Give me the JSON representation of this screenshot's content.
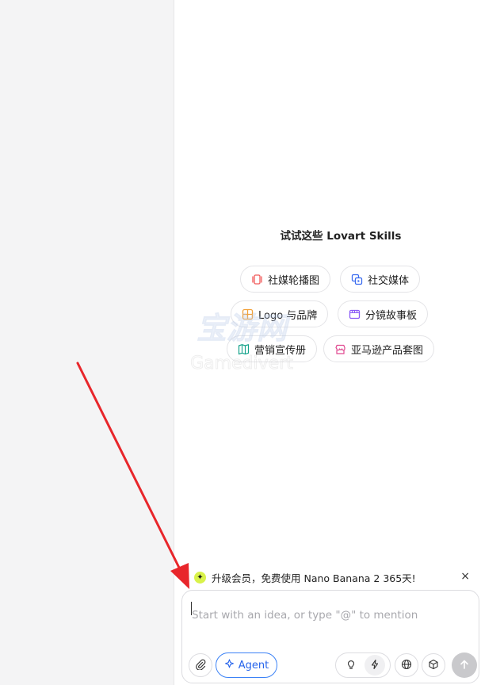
{
  "skills": {
    "title": "试试这些 Lovart Skills",
    "chips": [
      {
        "label": "社媒轮播图",
        "icon": "carousel-icon",
        "color": "#f05a5a"
      },
      {
        "label": "社交媒体",
        "icon": "social-media-icon",
        "color": "#3b6cf0"
      },
      {
        "label": "Logo 与品牌",
        "icon": "logo-brand-icon",
        "color": "#f2a13a"
      },
      {
        "label": "分镜故事板",
        "icon": "storyboard-icon",
        "color": "#8b5cf6"
      },
      {
        "label": "营销宣传册",
        "icon": "brochure-icon",
        "color": "#14a38b"
      },
      {
        "label": "亚马逊产品套图",
        "icon": "store-icon",
        "color": "#e0488f"
      }
    ]
  },
  "banner": {
    "text": "升级会员，免费使用 Nano Banana 2 365天!",
    "icon": "sparkle-icon",
    "close": "×"
  },
  "composer": {
    "placeholder": "Start with an idea, or type \"@\" to mention",
    "agent_label": "Agent",
    "accent": "#2563eb"
  },
  "watermark": {
    "line1": "宝游网",
    "line2": "Gamedivert"
  }
}
